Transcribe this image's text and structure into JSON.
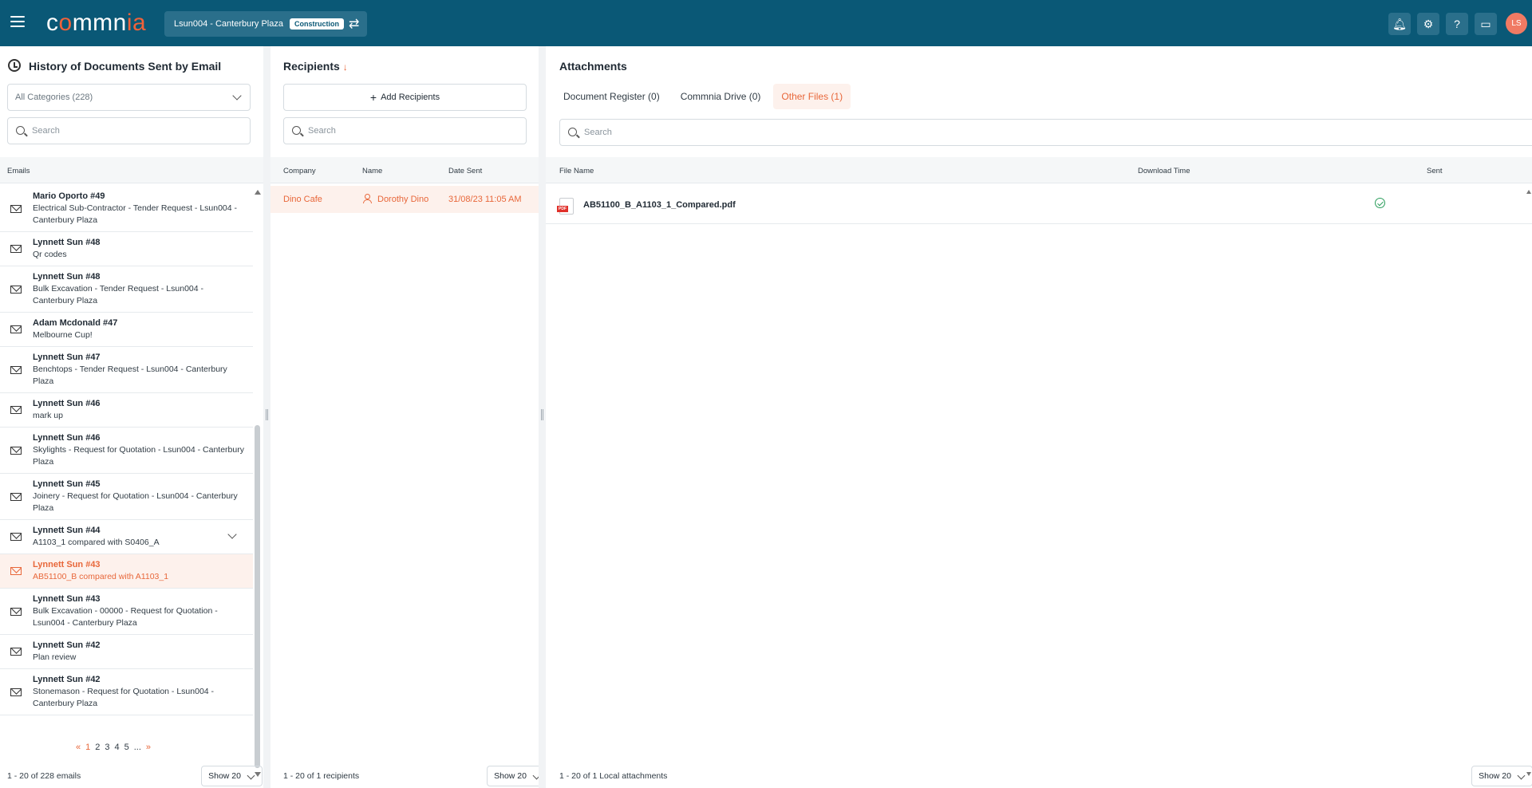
{
  "header": {
    "logo": "commnia",
    "project": "Lsun004 - Canterbury Plaza",
    "project_badge": "Construction",
    "avatar_initials": "LS",
    "brand_color": "#0a5876",
    "accent_color": "#e8673a"
  },
  "history": {
    "title": "History of Documents Sent by Email",
    "category_select": "All Categories (228)",
    "search_placeholder": "Search",
    "column_emails": "Emails",
    "emails": [
      {
        "from": "Mario Oporto #49",
        "subject": "Electrical Sub-Contractor - Tender Request - Lsun004 - Canterbury Plaza"
      },
      {
        "from": "Lynnett Sun #48",
        "subject": "Qr codes"
      },
      {
        "from": "Lynnett Sun #48",
        "subject": "Bulk Excavation - Tender Request - Lsun004 - Canterbury Plaza"
      },
      {
        "from": "Adam Mcdonald #47",
        "subject": "Melbourne Cup!"
      },
      {
        "from": "Lynnett Sun #47",
        "subject": "Benchtops - Tender Request - Lsun004 - Canterbury Plaza"
      },
      {
        "from": "Lynnett Sun #46",
        "subject": "mark up"
      },
      {
        "from": "Lynnett Sun #46",
        "subject": "Skylights - Request for Quotation - Lsun004 - Canterbury Plaza"
      },
      {
        "from": "Lynnett Sun #45",
        "subject": "Joinery - Request for Quotation - Lsun004 - Canterbury Plaza"
      },
      {
        "from": "Lynnett Sun #44",
        "subject": "A1103_1 compared with S0406_A"
      },
      {
        "from": "Lynnett Sun #43",
        "subject": "AB51100_B compared with A1103_1"
      },
      {
        "from": "Lynnett Sun #43",
        "subject": "Bulk Excavation - 00000 - Request for Quotation - Lsun004 - Canterbury Plaza"
      },
      {
        "from": "Lynnett Sun #42",
        "subject": "Plan review"
      },
      {
        "from": "Lynnett Sun #42",
        "subject": "Stonemason - Request for Quotation - Lsun004 - Canterbury Plaza"
      }
    ],
    "pager": {
      "prev": "«",
      "pages": [
        "1",
        "2",
        "3",
        "4",
        "5",
        "..."
      ],
      "next": "»"
    },
    "count": "1 - 20 of 228 emails",
    "show": "Show 20"
  },
  "recipients": {
    "title": "Recipients",
    "sort_arrow": "↓",
    "add_label": "Add Recipients",
    "search_placeholder": "Search",
    "col_company": "Company",
    "col_name": "Name",
    "col_date": "Date Sent",
    "rows": [
      {
        "company": "Dino Cafe",
        "name": "Dorothy Dino",
        "date": "31/08/23 11:05 AM"
      }
    ],
    "count": "1 - 20 of 1 recipients",
    "show": "Show 20"
  },
  "attachments": {
    "title": "Attachments",
    "tabs": [
      "Document Register (0)",
      "Commnia Drive (0)",
      "Other Files (1)"
    ],
    "search_placeholder": "Search",
    "col_file": "File Name",
    "col_download": "Download Time",
    "col_sent": "Sent",
    "files": [
      {
        "name": "AB51100_B_A1103_1_Compared.pdf",
        "download_time": "",
        "sent": "sent-check-icon"
      }
    ],
    "pdf_badge": "PDF",
    "count": "1 - 20 of 1 Local attachments",
    "show": "Show 20"
  }
}
